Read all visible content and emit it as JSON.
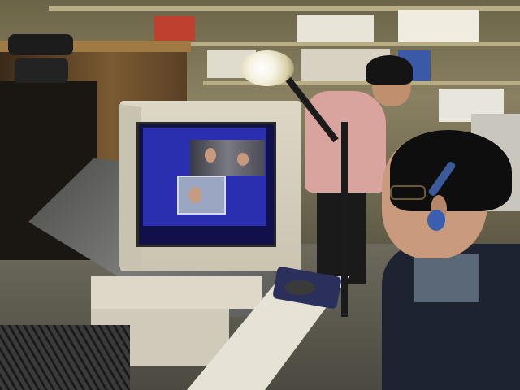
{
  "scene": {
    "description_tags": [
      "office",
      "video-conference",
      "crt-monitor",
      "desk-lamp",
      "headset",
      "bookshelves"
    ],
    "colors": {
      "screen_blue": "#2a2fb0",
      "lamp_light": "#f6f3e4",
      "woman_sweater": "#d9a49e",
      "man_jacket": "#1d2330",
      "headset_blue": "#3b5fb0"
    }
  }
}
